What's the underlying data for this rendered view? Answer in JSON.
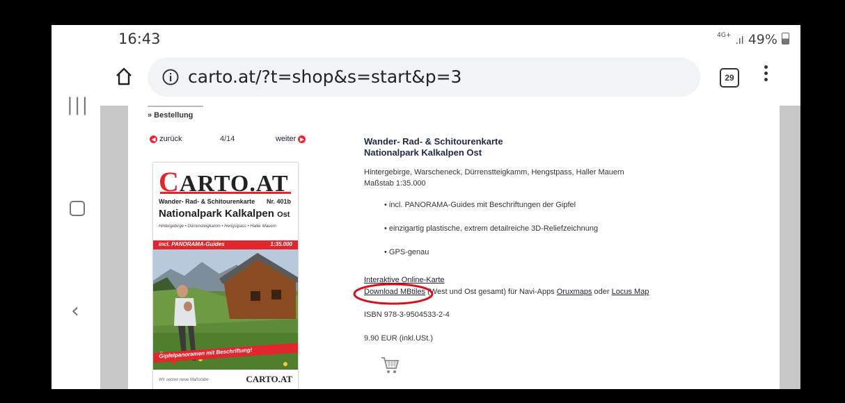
{
  "status_bar": {
    "time": "16:43",
    "network": "4G+",
    "battery": "49%"
  },
  "browser": {
    "url": "carto.at/?t=shop&s=start&p=3",
    "tab_count": "29"
  },
  "page": {
    "breadcrumb": "» Bestellung",
    "pager": {
      "back": "zurück",
      "position": "4/14",
      "next": "weiter"
    },
    "title_line1": "Wander- Rad- & Schitourenkarte",
    "title_line2": "Nationalpark Kalkalpen Ost",
    "regions": "Hintergebirge, Warscheneck, Dürrenstteigkamm, Hengstpass, Haller Mauern",
    "scale": "Maßstab 1:35.000",
    "bullets": [
      "incl. PANORAMA-Guides mit Beschriftungen der Gipfel",
      "einzigartig plastische, extrem detailreiche 3D-Reliefzeichnung",
      "GPS-genau"
    ],
    "interactive_link": "Interaktive Online-Karte",
    "download_link": "Download MBtiles",
    "download_text": " (West und Ost gesamt) für Navi-Apps ",
    "oruxmaps_link": "Oruxmaps",
    "oder": " oder ",
    "locus_link": "Locus Map",
    "isbn": "ISBN 978-3-9504533-2-4",
    "price": "9.90 EUR (inkl.USt.)"
  },
  "cover": {
    "brand_c": "C",
    "brand_rest": "ARTO.AT",
    "series": "Wander- Rad- & Schitourenkarte",
    "number": "Nr. 401b",
    "title": "Nationalpark Kalkalpen",
    "title_suffix": "Ost",
    "places": "Hintergebirge • Dürrensteigkamm • Hengstpass • Haller Mauern",
    "band_left": "incl. PANORAMA-Guides",
    "band_right": "1:35.000",
    "ribbon": "Gipfelpanoramen mit Beschriftung!",
    "footer_left": "Wir setzen neue Maßstäbe",
    "footer_brand": "CARTO.AT"
  },
  "colors": {
    "accent_red": "#e2262e",
    "annotation_red": "#d8101c",
    "page_gray": "#c7c7c7"
  }
}
